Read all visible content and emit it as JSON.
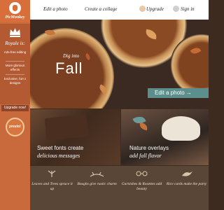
{
  "brand": {
    "name": "PicMonkey"
  },
  "sidebar": {
    "royal_title": "Royale is:",
    "perks": [
      "Ads-free editing",
      "More glorious effects",
      "Exclusive, fun-z designs"
    ],
    "upgrade_label": "Upgrade now!",
    "badge_label": "presto!"
  },
  "topbar": {
    "edit_label": "Edit a photo",
    "collage_label": "Create a collage",
    "upgrade_label": "Upgrade",
    "signin_label": "Sign in"
  },
  "hero": {
    "subtitle": "Dig into",
    "title": "Fall",
    "cta_label": "Edit a photo →"
  },
  "tiles": [
    {
      "line1": "Sweet fonts create",
      "line2": "delicious messages"
    },
    {
      "line1": "Nature overlays",
      "line2": "add fall flavor"
    }
  ],
  "strip": [
    {
      "icon": "leaves-icon",
      "text": "Leaves and Trees spruce it up"
    },
    {
      "icon": "branches-icon",
      "text": "Boughs give rustic charm"
    },
    {
      "icon": "garnish-icon",
      "text": "Garnishes & Rosettes add beauty"
    },
    {
      "icon": "bird-icon",
      "text": "Rice cards make the party"
    }
  ],
  "colors": {
    "brand_orange": "#d86f3a",
    "teal": "#5c8f8c",
    "brown": "#3d2b20"
  }
}
